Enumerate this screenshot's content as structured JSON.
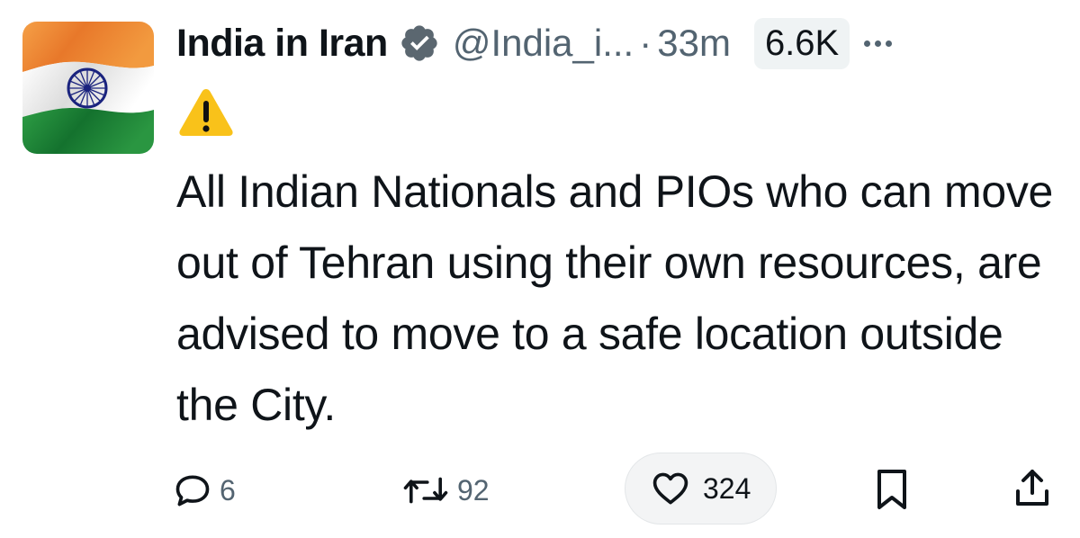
{
  "author": {
    "display_name": "India in Iran",
    "handle": "@India_i...",
    "separator": "·",
    "time_ago": "33m",
    "verified_icon": "verified-badge-icon",
    "avatar_icon": "india-flag-avatar",
    "verified_color": "#657786"
  },
  "views": "6.6K",
  "tweet": {
    "warning_icon": "warning-emoji-icon",
    "text": "All Indian Nationals and PIOs who can move out of Tehran using their own resources, are advised to move to a safe location outside the City."
  },
  "actions": {
    "reply": {
      "icon": "reply-icon",
      "count": "6"
    },
    "retweet": {
      "icon": "retweet-icon",
      "count": "92"
    },
    "like": {
      "icon": "heart-icon",
      "count": "324"
    },
    "bookmark": {
      "icon": "bookmark-icon"
    },
    "share": {
      "icon": "share-icon"
    }
  },
  "colors": {
    "text": "#0f1419",
    "secondary": "#536471",
    "saffron": "#f08a24",
    "green": "#1f8a3a",
    "chakra": "#1a237e"
  }
}
